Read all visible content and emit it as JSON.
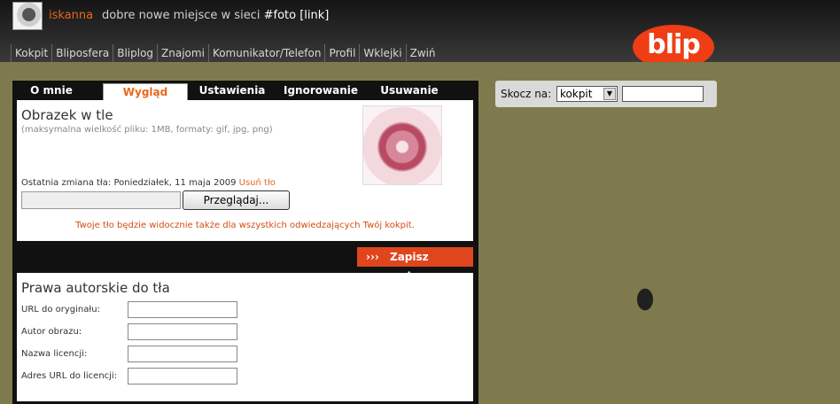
{
  "header": {
    "username": "iskanna",
    "status": "dobre nowe miejsce w sieci",
    "status_tag": "#foto [link]",
    "logo": "blip"
  },
  "nav": [
    "Kokpit",
    "Bliposfera",
    "Bliplog",
    "Znajomi",
    "Komunikator/Telefon",
    "Profil",
    "Wklejki",
    "Zwiń"
  ],
  "tabs": [
    "O mnie",
    "Wygląd",
    "Ustawienia",
    "Ignorowanie",
    "Usuwanie konta"
  ],
  "background_box": {
    "title": "Obrazek w tle",
    "subtitle": "(maksymalna wielkość pliku: 1MB, formaty: gif, jpg, png)",
    "last_change": "Ostatnia zmiana tła: Poniedziałek, 11 maja 2009",
    "remove_link": "Usuń tło",
    "browse_label": "Przeglądaj...",
    "note": "Twoje tło będzie widocznie także dla wszystkich odwiedzających Twój kokpit."
  },
  "save_button": {
    "arrows": "›››",
    "label": "Zapisz zmiany"
  },
  "copyright_box": {
    "title": "Prawa autorskie do tła",
    "fields": [
      "URL do oryginału:",
      "Autor obrazu:",
      "Nazwa licencji:",
      "Adres URL do licencji:"
    ]
  },
  "jump": {
    "label": "Skocz na:",
    "selected": "kokpit"
  },
  "colors": {
    "accent": "#e8671c",
    "save_button": "#e0461c",
    "logo": "#ef3d16"
  }
}
